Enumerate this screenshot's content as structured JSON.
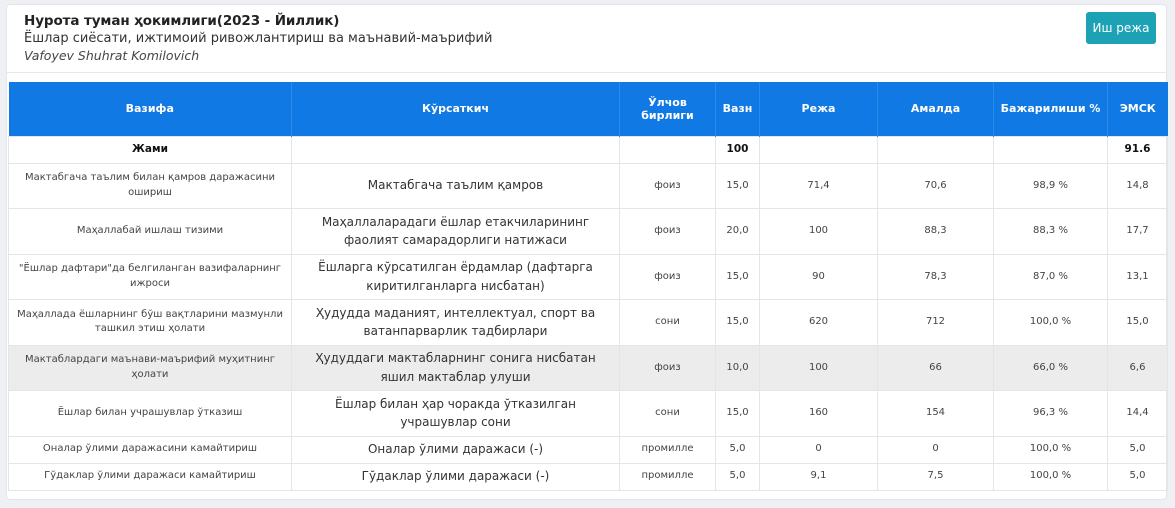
{
  "header": {
    "title": "Нурота туман ҳокимлиги(2023 - Йиллик)",
    "subtitle": "Ёшлар сиёсати, ижтимоий ривожлантириш ва маънавий-маърифий",
    "person": "Vafoyev Shuhrat Komilovich",
    "plan_button": "Иш режа"
  },
  "table": {
    "columns": [
      "Вазифа",
      "Кўрсаткич",
      "Ўлчов бирлиги",
      "Вазн",
      "Режа",
      "Амалда",
      "Бажарилиши %",
      "ЭМСК"
    ],
    "total": {
      "label": "Жами",
      "weight": "100",
      "emsk": "91.6"
    },
    "rows": [
      {
        "task": "Мактабгача таълим билан қамров даражасини ошириш",
        "indicator": "Мактабгача таълим қамров",
        "unit": "фоиз",
        "weight": "15,0",
        "plan": "71,4",
        "actual": "70,6",
        "percent": "98,9 %",
        "emsk": "14,8"
      },
      {
        "task": "Маҳаллабай ишлаш тизими",
        "indicator": "Маҳаллаларадаги ёшлар етакчиларининг фаолият самарадорлиги натижаси",
        "unit": "фоиз",
        "weight": "20,0",
        "plan": "100",
        "actual": "88,3",
        "percent": "88,3 %",
        "emsk": "17,7"
      },
      {
        "task": "\"Ёшлар дафтари\"да белгиланган вазифаларнинг ижроси",
        "indicator": "Ёшларга кўрсатилган ёрдамлар (дафтарга киритилганларга нисбатан)",
        "unit": "фоиз",
        "weight": "15,0",
        "plan": "90",
        "actual": "78,3",
        "percent": "87,0 %",
        "emsk": "13,1"
      },
      {
        "task": "Маҳаллада ёшларнинг бўш вақтларини мазмунли ташкил этиш ҳолати",
        "indicator": "Ҳудудда маданият, интеллектуал, спорт ва ватанпарварлик тадбирлари",
        "unit": "сони",
        "weight": "15,0",
        "plan": "620",
        "actual": "712",
        "percent": "100,0 %",
        "emsk": "15,0"
      },
      {
        "task": "Мактаблардаги маънави-маърифий муҳитнинг ҳолати",
        "indicator": "Ҳудуддаги мактабларнинг сонига нисбатан яшил мактаблар улуши",
        "unit": "фоиз",
        "weight": "10,0",
        "plan": "100",
        "actual": "66",
        "percent": "66,0 %",
        "emsk": "6,6"
      },
      {
        "task": "Ёшлар билан учрашувлар ўтказиш",
        "indicator": "Ёшлар билан ҳар чоракда ўтказилган учрашувлар сони",
        "unit": "сони",
        "weight": "15,0",
        "plan": "160",
        "actual": "154",
        "percent": "96,3 %",
        "emsk": "14,4"
      },
      {
        "task": "Оналар ўлими даражасини камайтириш",
        "indicator": "Оналар ўлими даражаси (-)",
        "unit": "промилле",
        "weight": "5,0",
        "plan": "0",
        "actual": "0",
        "percent": "100,0 %",
        "emsk": "5,0"
      },
      {
        "task": "Гўдаклар ўлими даражаси камайтириш",
        "indicator": "Гўдаклар ўлими даражаси (-)",
        "unit": "промилле",
        "weight": "5,0",
        "plan": "9,1",
        "actual": "7,5",
        "percent": "100,0 %",
        "emsk": "5,0"
      }
    ]
  }
}
